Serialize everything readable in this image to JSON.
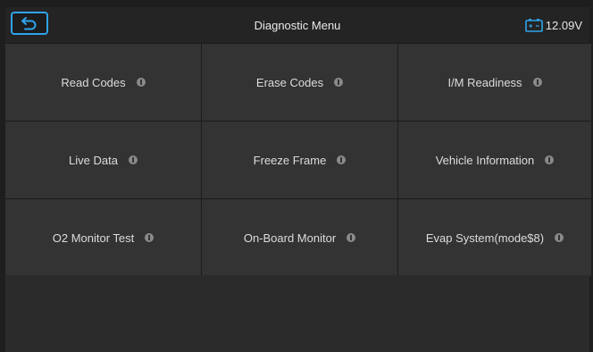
{
  "header": {
    "title": "Diagnostic Menu",
    "battery_voltage": "12.09V",
    "back_icon": "back-arrow-icon",
    "battery_icon": "battery-icon"
  },
  "menu": {
    "items": [
      {
        "label": "Read Codes"
      },
      {
        "label": "Erase Codes"
      },
      {
        "label": "I/M Readiness"
      },
      {
        "label": "Live Data"
      },
      {
        "label": "Freeze Frame"
      },
      {
        "label": "Vehicle Information"
      },
      {
        "label": "O2 Monitor Test"
      },
      {
        "label": "On-Board Monitor"
      },
      {
        "label": "Evap System(mode$8)"
      }
    ],
    "info_icon": "info-icon"
  },
  "colors": {
    "accent": "#2ea3ea",
    "background": "#2b2b2b",
    "tile": "#333333",
    "text": "#dcdcdc"
  }
}
